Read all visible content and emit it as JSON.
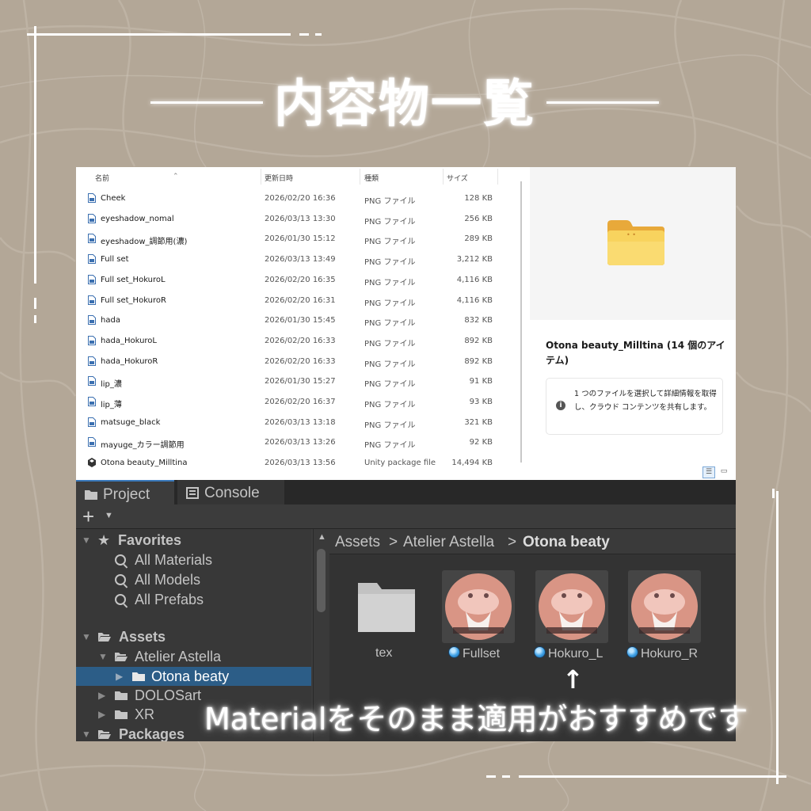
{
  "colors": {
    "background": "#b3a797",
    "frame": "#ffffff",
    "unity_panel": "#3c3c3c",
    "unity_selection": "#2c5d87",
    "folder_yellow": "#f6c84a"
  },
  "heading": "内容物一覧",
  "explorer": {
    "columns": {
      "name": "名前",
      "date": "更新日時",
      "type": "種類",
      "size": "サイズ"
    },
    "files": [
      {
        "name": "Cheek",
        "date": "2026/02/20 16:36",
        "type": "PNG ファイル",
        "size": "128 KB",
        "icon": "image-file-icon"
      },
      {
        "name": "eyeshadow_nomal",
        "date": "2026/03/13 13:30",
        "type": "PNG ファイル",
        "size": "256 KB",
        "icon": "image-file-icon"
      },
      {
        "name": "eyeshadow_調節用(濃)",
        "date": "2026/01/30 15:12",
        "type": "PNG ファイル",
        "size": "289 KB",
        "icon": "image-file-icon"
      },
      {
        "name": "Full set",
        "date": "2026/03/13 13:49",
        "type": "PNG ファイル",
        "size": "3,212 KB",
        "icon": "image-file-icon"
      },
      {
        "name": "Full set_HokuroL",
        "date": "2026/02/20 16:35",
        "type": "PNG ファイル",
        "size": "4,116 KB",
        "icon": "image-file-icon"
      },
      {
        "name": "Full set_HokuroR",
        "date": "2026/02/20 16:31",
        "type": "PNG ファイル",
        "size": "4,116 KB",
        "icon": "image-file-icon"
      },
      {
        "name": "hada",
        "date": "2026/01/30 15:45",
        "type": "PNG ファイル",
        "size": "832 KB",
        "icon": "image-file-icon"
      },
      {
        "name": "hada_HokuroL",
        "date": "2026/02/20 16:33",
        "type": "PNG ファイル",
        "size": "892 KB",
        "icon": "image-file-icon"
      },
      {
        "name": "hada_HokuroR",
        "date": "2026/02/20 16:33",
        "type": "PNG ファイル",
        "size": "892 KB",
        "icon": "image-file-icon"
      },
      {
        "name": "lip_濃",
        "date": "2026/01/30 15:27",
        "type": "PNG ファイル",
        "size": "91 KB",
        "icon": "image-file-icon"
      },
      {
        "name": "lip_薄",
        "date": "2026/02/20 16:37",
        "type": "PNG ファイル",
        "size": "93 KB",
        "icon": "image-file-icon"
      },
      {
        "name": "matsuge_black",
        "date": "2026/03/13 13:18",
        "type": "PNG ファイル",
        "size": "321 KB",
        "icon": "image-file-icon"
      },
      {
        "name": "mayuge_カラー調節用",
        "date": "2026/03/13 13:26",
        "type": "PNG ファイル",
        "size": "92 KB",
        "icon": "image-file-icon"
      },
      {
        "name": "Otona beauty_Milltina",
        "date": "2026/03/13 13:56",
        "type": "Unity package file",
        "size": "14,494 KB",
        "icon": "unity-package-icon"
      }
    ],
    "details": {
      "title": "Otona beauty_Milltina (14 個のアイテム)",
      "info": "1 つのファイルを選択して詳細情報を取得し、クラウド コンテンツを共有します。",
      "preview_icon": "folder-icon"
    }
  },
  "unity": {
    "tabs": [
      {
        "label": "Project",
        "icon": "folder-icon",
        "active": true
      },
      {
        "label": "Console",
        "icon": "console-icon",
        "active": false
      }
    ],
    "toolbar": {
      "create_label": "+",
      "create_dropdown_icon": "chevron-down-icon"
    },
    "tree": {
      "favorites": "Favorites",
      "fav_items": [
        "All Materials",
        "All Models",
        "All Prefabs"
      ],
      "assets": "Assets",
      "atelier": "Atelier Astella",
      "otona": "Otona beaty",
      "dolo": "DOLOSart",
      "xr": "XR",
      "packages": "Packages"
    },
    "breadcrumb": [
      "Assets",
      "Atelier Astella",
      "Otona beaty"
    ],
    "assets": [
      {
        "label": "tex",
        "kind": "folder"
      },
      {
        "label": "Fullset",
        "kind": "material"
      },
      {
        "label": "Hokuro_L",
        "kind": "material"
      },
      {
        "label": "Hokuro_R",
        "kind": "material"
      }
    ]
  },
  "annotation": {
    "arrow": "↑",
    "caption": "Materialをそのまま適用がおすすめです"
  }
}
